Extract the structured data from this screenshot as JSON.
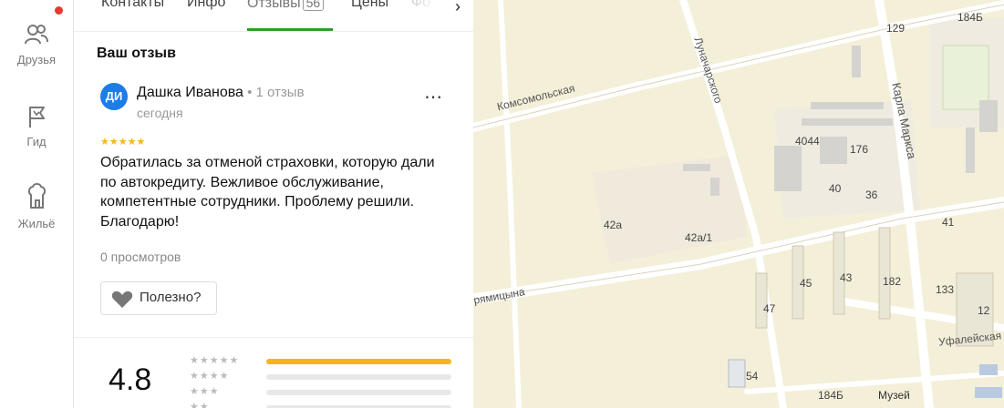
{
  "rail": {
    "items": [
      {
        "label": "Друзья",
        "icon": "friends-icon"
      },
      {
        "label": "Гид",
        "icon": "flag-icon"
      },
      {
        "label": "Жильё",
        "icon": "housing-icon"
      }
    ],
    "notification_color": "#e53935"
  },
  "tabs": {
    "items": [
      "Контакты",
      "Инфо",
      "Отзывы",
      "Цены",
      "Фо"
    ],
    "active": "Отзывы",
    "reviews_count": "56"
  },
  "review": {
    "section_title": "Ваш отзыв",
    "avatar_initials": "ДИ",
    "author": "Дашка Иванова",
    "author_meta": " • 1 отзыв",
    "date": "сегодня",
    "stars": "★★★★★",
    "text": "Обратилась за отменой страховки, которую дали по автокредиту. Вежливое обслуживание, компетентные сотрудники. Проблему решили. Благодарю!",
    "views": "0 просмотров",
    "helpful_label": "Полезно?",
    "star_rating": 5
  },
  "summary": {
    "rating": "4.8",
    "bars": [
      {
        "stars": "★★★★★",
        "fill": 1.0
      },
      {
        "stars": "★★★★",
        "fill": 0.0
      },
      {
        "stars": "★★★",
        "fill": 0.0
      },
      {
        "stars": "★★",
        "fill": 0.0
      }
    ]
  },
  "map": {
    "streets": [
      "Комсомольская",
      "Луначарского",
      "Карла Маркса",
      "Уфалейская",
      "рямицына"
    ],
    "numbers": [
      "184Б",
      "129",
      "4044",
      "176",
      "40",
      "36",
      "41",
      "42а",
      "42а/1",
      "45",
      "43",
      "182",
      "133",
      "12",
      "47",
      "54",
      "184Б",
      "Музей"
    ]
  },
  "colors": {
    "accent_green": "#2c9e2c",
    "star_yellow": "#f5b521",
    "avatar_blue": "#1e7ce8",
    "map_background": "#f4efd8"
  }
}
